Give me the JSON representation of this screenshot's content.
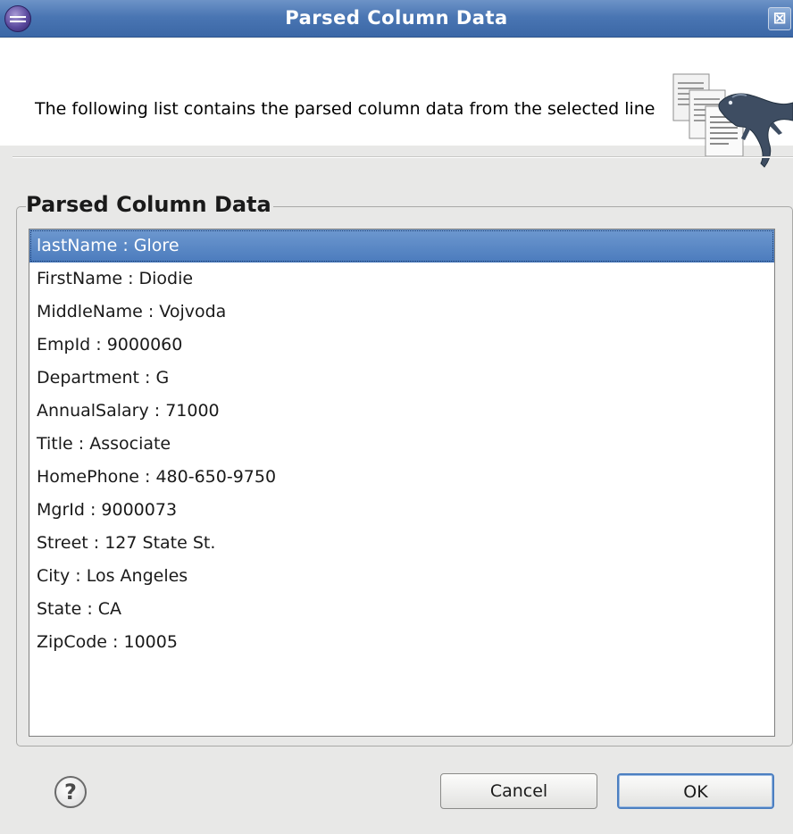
{
  "window": {
    "title": "Parsed Column Data",
    "close_glyph": "⊠"
  },
  "header": {
    "message": "The following list contains the parsed column data from the selected line",
    "image_icon": "documents-with-lizard-icon"
  },
  "group": {
    "title": "Parsed Column Data"
  },
  "list": {
    "selected_index": 0,
    "items": [
      "lastName  :  Glore",
      "FirstName  :  Diodie",
      "MiddleName  :  Vojvoda",
      "EmpId  :  9000060",
      "Department  :  G",
      "AnnualSalary  :  71000",
      "Title  :  Associate",
      "HomePhone  :  480-650-9750",
      "MgrId  :  9000073",
      "Street  :  127 State St.",
      "City  :  Los Angeles",
      "State  :  CA",
      "ZipCode  :  10005"
    ]
  },
  "footer": {
    "help_glyph": "?",
    "cancel_label": "Cancel",
    "ok_label": "OK"
  },
  "colors": {
    "titlebar": "#4a76b3",
    "selection": "#5a89c6",
    "background": "#e8e8e7"
  }
}
